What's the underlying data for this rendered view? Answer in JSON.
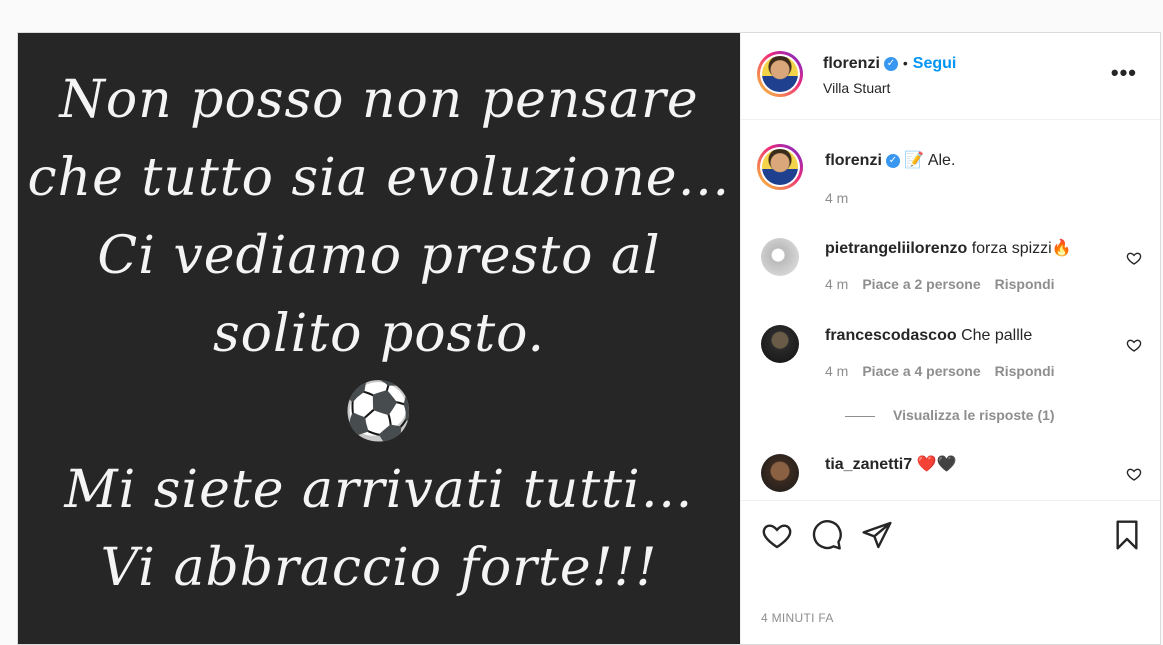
{
  "media": {
    "lines": [
      "Non posso non pensare",
      "che tutto sia evoluzione…",
      "Ci vediamo presto al",
      "solito posto.",
      "⚽",
      "Mi siete arrivati tutti…",
      "Vi abbraccio forte!!!"
    ]
  },
  "header": {
    "username": "florenzi",
    "dot": "•",
    "follow_label": "Segui",
    "location": "Villa Stuart",
    "more": "•••"
  },
  "caption": {
    "username": "florenzi",
    "text": "📝 Ale.",
    "time": "4 m"
  },
  "comments": [
    {
      "username": "pietrangeliilorenzo",
      "text": "forza spizzi🔥",
      "time": "4 m",
      "likes": "Piace a 2 persone",
      "reply": "Rispondi"
    },
    {
      "username": "francescodascoo",
      "text": "Che pallle",
      "time": "4 m",
      "likes": "Piace a 4 persone",
      "reply": "Rispondi",
      "view_replies": "Visualizza le risposte (1)"
    },
    {
      "username": "tia_zanetti7",
      "text": "❤️🖤"
    }
  ],
  "footer": {
    "time_ago": "4 MINUTI FA"
  },
  "icons": {
    "like": "heart-icon",
    "comment": "comment-icon",
    "share": "paper-plane-icon",
    "save": "bookmark-icon"
  }
}
